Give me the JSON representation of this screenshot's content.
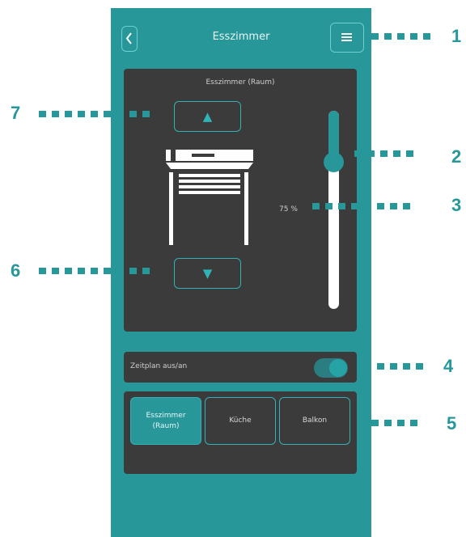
{
  "header": {
    "title": "Esszimmer",
    "back_icon": "chevron-left-icon",
    "menu_icon": "hamburger-menu-icon"
  },
  "control_panel": {
    "room_label": "Esszimmer (Raum)",
    "up_icon": "triangle-up-icon",
    "down_icon": "triangle-down-icon",
    "illustration": "roller-shutter-icon",
    "slider_value_label": "75 %",
    "slider_fraction": 0.75
  },
  "schedule": {
    "label": "Zeitplan aus/an",
    "enabled": true
  },
  "room_tabs": [
    {
      "label": "Esszimmer (Raum)",
      "active": true
    },
    {
      "label": "Küche",
      "active": false
    },
    {
      "label": "Balkon",
      "active": false
    }
  ],
  "callouts": [
    "1",
    "2",
    "3",
    "4",
    "5",
    "6",
    "7"
  ],
  "colors": {
    "accent": "#27979a",
    "accent_light": "#2fb3b6",
    "panel": "#3b3b3b"
  }
}
